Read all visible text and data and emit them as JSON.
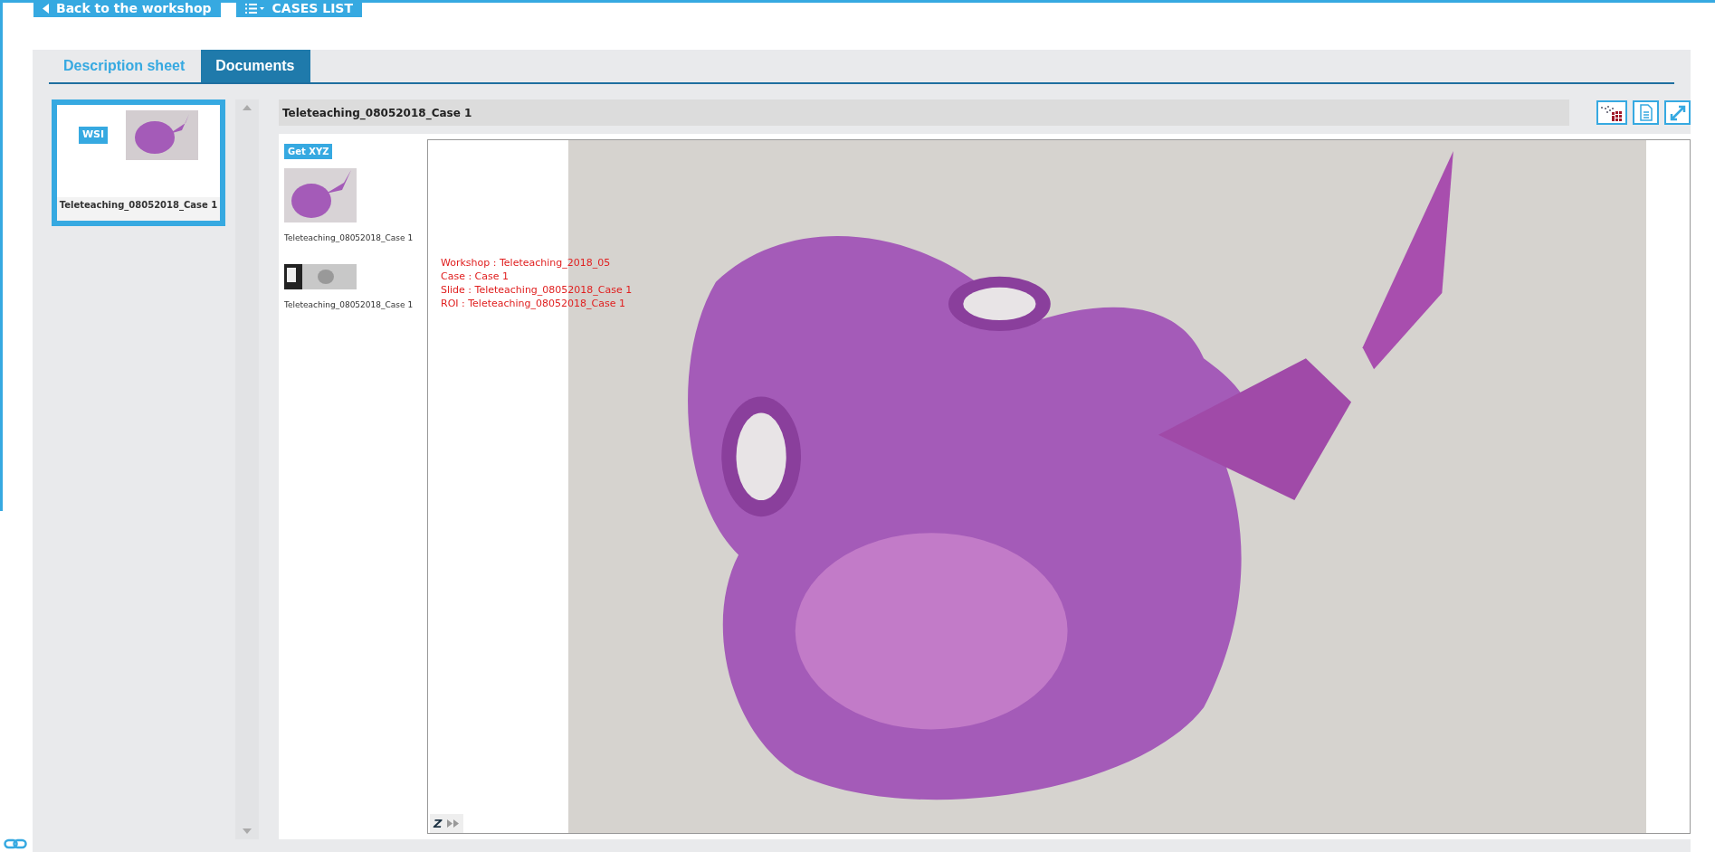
{
  "header_buttons": [
    {
      "kind": "back",
      "label": "Back to the workshop"
    },
    {
      "kind": "list",
      "label": "CASES LIST"
    }
  ],
  "tabs": [
    {
      "label": "Description sheet",
      "selected": false
    },
    {
      "label": "Documents",
      "selected": true
    }
  ],
  "documents": [
    {
      "badge": "WSI",
      "label": "Teleteaching_08052018_Case 1",
      "selected": true
    }
  ],
  "viewer": {
    "title": "Teleteaching_08052018_Case 1",
    "get_xyz": "Get XYZ",
    "thumbnails": [
      {
        "kind": "slide",
        "label": "Teleteaching_08052018_Case 1"
      },
      {
        "kind": "label",
        "label": "Teleteaching_08052018_Case 1"
      }
    ],
    "overlay_lines": [
      "Workshop : Teleteaching_2018_05",
      "Case : Case 1",
      "Slide : Teleteaching_08052018_Case 1",
      "ROI : Teleteaching_08052018_Case 1"
    ],
    "zoom_label": "Z"
  }
}
